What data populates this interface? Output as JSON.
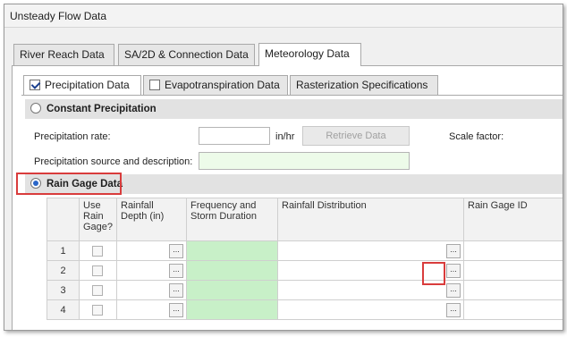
{
  "window": {
    "title": "Unsteady Flow Data"
  },
  "outer_tabs": [
    {
      "label": "River Reach Data"
    },
    {
      "label": "SA/2D & Connection Data"
    },
    {
      "label": "Meteorology Data",
      "active": true
    }
  ],
  "inner_tabs": [
    {
      "label": "Precipitation Data",
      "checked": true,
      "active": true
    },
    {
      "label": "Evapotranspiration Data",
      "checked": false
    },
    {
      "label": "Rasterization Specifications"
    }
  ],
  "constant_precip": {
    "label": "Constant Precipitation",
    "rate_label": "Precipitation rate:",
    "rate_unit": "in/hr",
    "retrieve_button": "Retrieve Data",
    "scale_factor_label": "Scale factor:",
    "source_label": "Precipitation source and description:"
  },
  "rain_gage": {
    "label": "Rain Gage Data",
    "columns": [
      "",
      "Use Rain Gage?",
      "Rainfall Depth (in)",
      "Frequency and Storm Duration",
      "Rainfall Distribution",
      "Rain Gage ID"
    ],
    "rows": [
      "1",
      "2",
      "3",
      "4"
    ]
  },
  "colors": {
    "highlight_red": "#d93c3c",
    "green_field": "#c8f0c8"
  }
}
